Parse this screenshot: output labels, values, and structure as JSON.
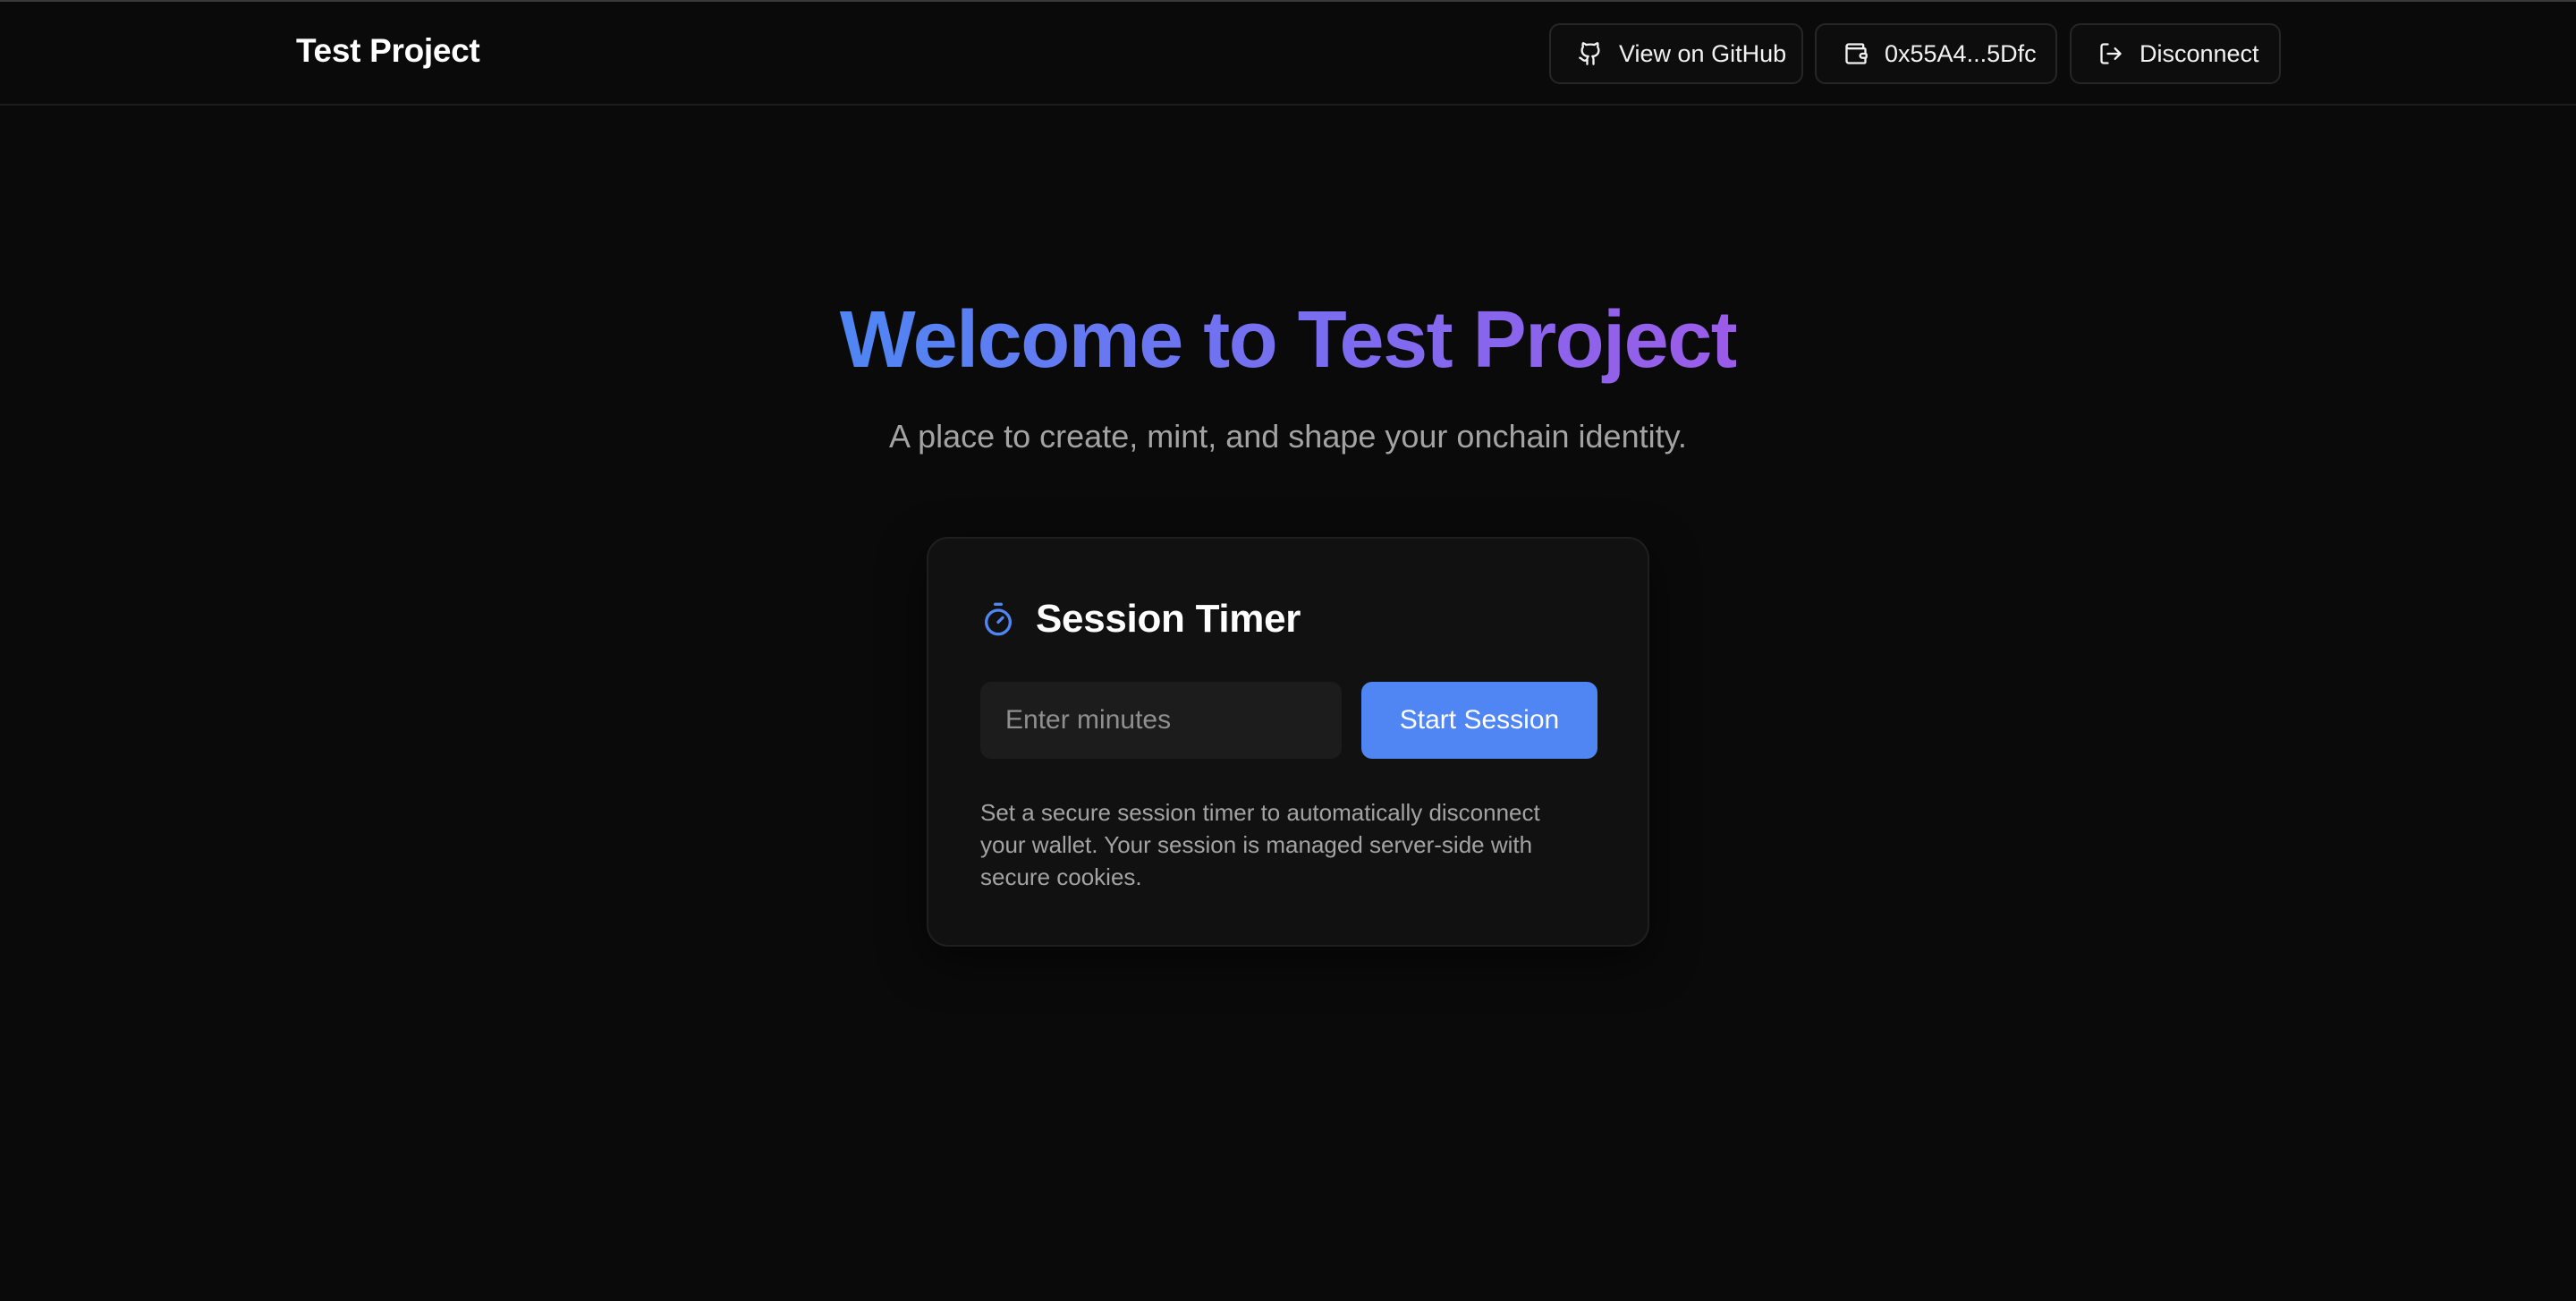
{
  "header": {
    "brand": "Test Project",
    "github_label": "View on GitHub",
    "wallet_label": "0x55A4...5Dfc",
    "disconnect_label": "Disconnect",
    "icons": {
      "github": "github-icon",
      "wallet": "wallet-icon",
      "disconnect": "log-out-icon"
    }
  },
  "hero": {
    "title": "Welcome to Test Project",
    "subtitle": "A place to create, mint, and shape your onchain identity."
  },
  "session_card": {
    "icon": "timer-icon",
    "title": "Session Timer",
    "input_value": "",
    "input_placeholder": "Enter minutes",
    "button_label": "Start Session",
    "description": "Set a secure session timer to automatically disconnect your wallet. Your session is managed server-side with secure cookies."
  },
  "colors": {
    "background": "#0a0a0a",
    "card": "#111111",
    "accent": "#4f86f3",
    "gradient_end": "#9b5ce8",
    "muted_text": "#a3a3a3"
  }
}
